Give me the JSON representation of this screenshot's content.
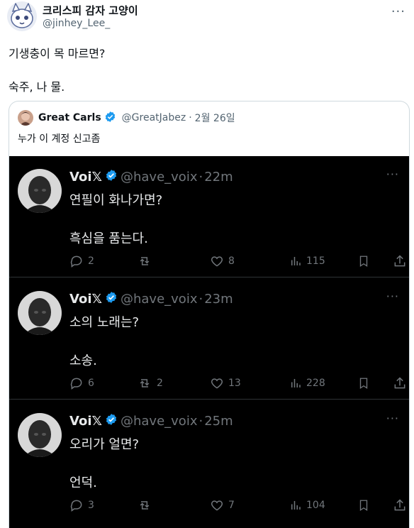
{
  "post": {
    "author_name": "크리스피 감자 고양이",
    "author_handle": "@jinhey_Lee_",
    "more": "···",
    "text_line1": "기생충이 목 마르면?",
    "text_line2": "숙주, 나 물."
  },
  "quote": {
    "author_name": "Great Carls",
    "author_handle": "@GreatJabez",
    "separator": "·",
    "date": "2월 26일",
    "text": "누가 이 계정 신고좀"
  },
  "embedded_tweets": [
    {
      "name": "Voi𝕏",
      "handle": "@have_voix",
      "separator": "·",
      "time": "22m",
      "more": "···",
      "line1": "연필이 화나가면?",
      "line2": "흑심을 품는다.",
      "replies": "2",
      "retweets": "",
      "likes": "8",
      "views": "115"
    },
    {
      "name": "Voi𝕏",
      "handle": "@have_voix",
      "separator": "·",
      "time": "23m",
      "more": "···",
      "line1": "소의 노래는?",
      "line2": "소송.",
      "replies": "6",
      "retweets": "2",
      "likes": "13",
      "views": "228"
    },
    {
      "name": "Voi𝕏",
      "handle": "@have_voix",
      "separator": "·",
      "time": "25m",
      "more": "···",
      "line1": "오리가 얼면?",
      "line2": "언덕.",
      "replies": "3",
      "retweets": "",
      "likes": "7",
      "views": "104"
    }
  ],
  "colors": {
    "verified": "#1d9bf0",
    "dark_bg": "#000000",
    "muted_dark": "#71767b",
    "muted_light": "#536471"
  }
}
